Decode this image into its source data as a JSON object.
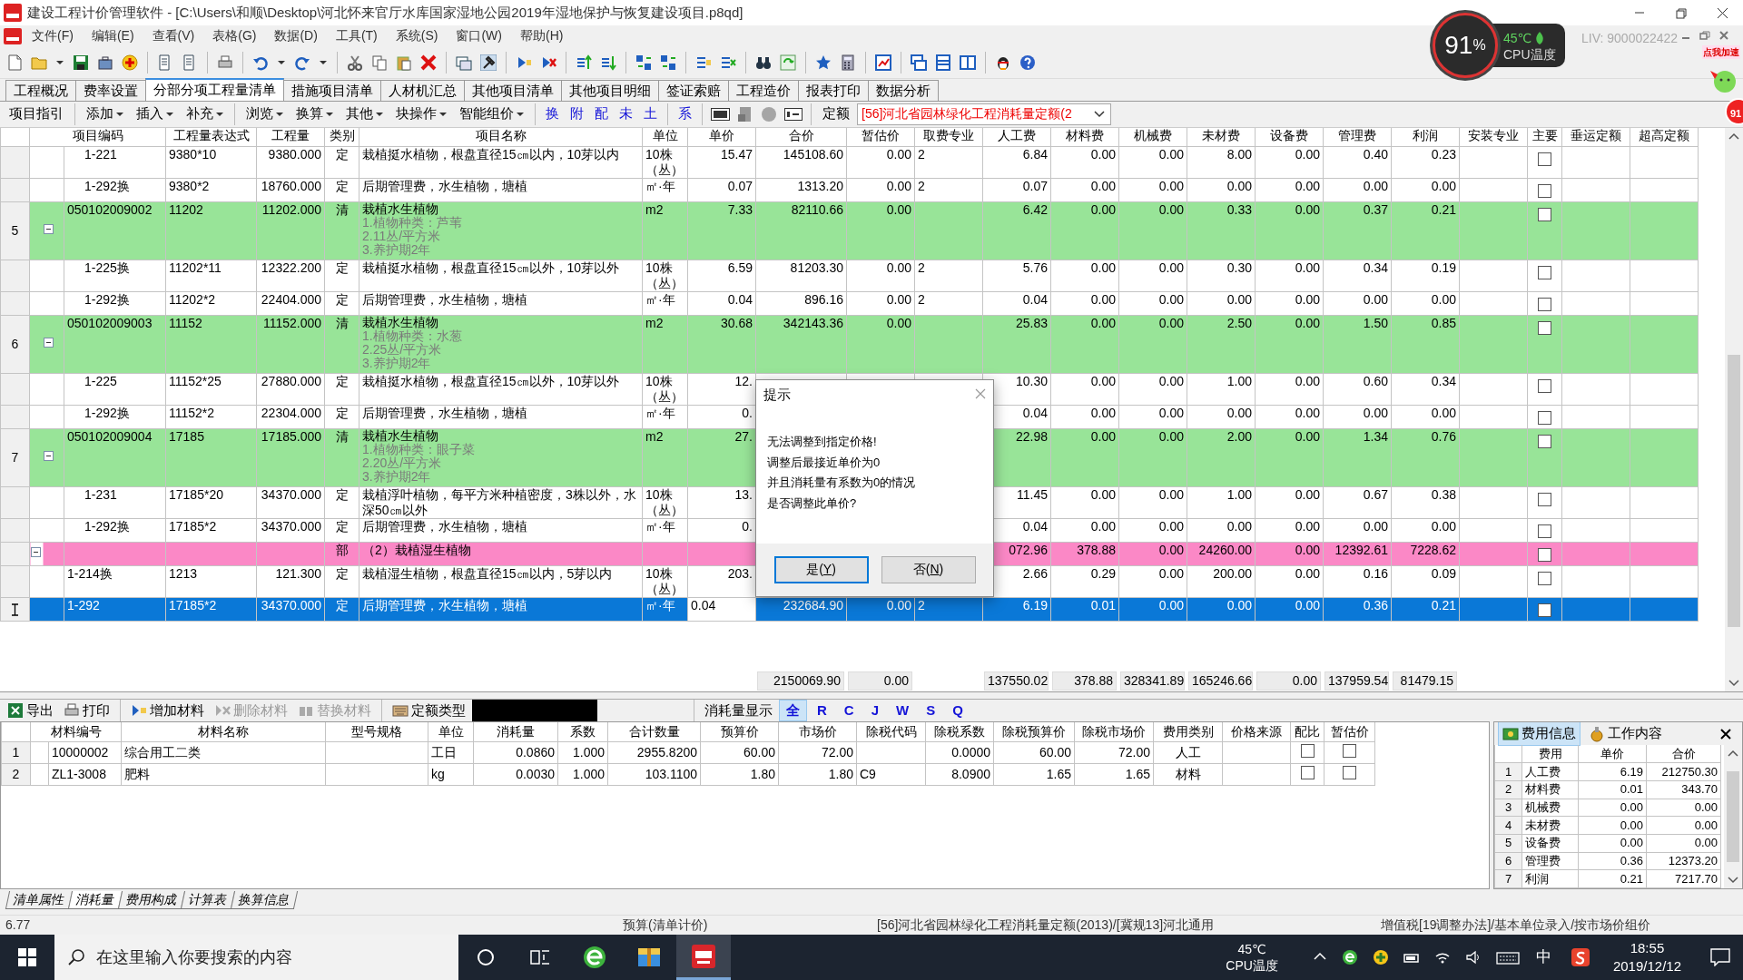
{
  "window": {
    "title": "建设工程计价管理软件 - [C:\\Users\\和顺\\Desktop\\河北怀来官厅水库国家湿地公园2019年湿地保护与恢复建设项目.p8qd]"
  },
  "menu": [
    "文件(F)",
    "编辑(E)",
    "查看(V)",
    "表格(G)",
    "数据(D)",
    "工具(T)",
    "系统(S)",
    "窗口(W)",
    "帮助(H)"
  ],
  "cpu_widget": {
    "percent": "91",
    "percent_unit": "%",
    "temperature": "45℃",
    "label": "CPU温度"
  },
  "license": "LIV: 9000022422",
  "speedup_badge": "点我加速",
  "alert_badge": "91",
  "tabs": [
    {
      "label": "工程概况",
      "selected": false
    },
    {
      "label": "费率设置",
      "selected": false
    },
    {
      "label": "分部分项工程量清单",
      "selected": true
    },
    {
      "label": "措施项目清单",
      "selected": false
    },
    {
      "label": "人材机汇总",
      "selected": false
    },
    {
      "label": "其他项目清单",
      "selected": false
    },
    {
      "label": "其他项目明细",
      "selected": false
    },
    {
      "label": "签证索赔",
      "selected": false
    },
    {
      "label": "工程造价",
      "selected": false
    },
    {
      "label": "报表打印",
      "selected": false
    },
    {
      "label": "数据分析",
      "selected": false
    }
  ],
  "subtoolbar": {
    "items": [
      {
        "label": "项目指引",
        "dropdown": false
      },
      {
        "label": "添加",
        "dropdown": true
      },
      {
        "label": "插入",
        "dropdown": true
      },
      {
        "label": "补充",
        "dropdown": true
      },
      {
        "label": "浏览",
        "dropdown": true
      },
      {
        "label": "换算",
        "dropdown": true
      },
      {
        "label": "其他",
        "dropdown": true
      },
      {
        "label": "块操作",
        "dropdown": true
      },
      {
        "label": "智能组价",
        "dropdown": true
      }
    ],
    "quick": [
      "换",
      "附",
      "配",
      "未",
      "土"
    ],
    "quick_extra": "系",
    "quota_label": "定额",
    "quota_select": "[56]河北省园林绿化工程消耗量定额(2"
  },
  "grid": {
    "columns": [
      "项目编码",
      "工程量表达式",
      "工程量",
      "类别",
      "项目名称",
      "单位",
      "单价",
      "合价",
      "暂估价",
      "取费专业",
      "人工费",
      "材料费",
      "机械费",
      "未材费",
      "设备费",
      "管理费",
      "利润",
      "安装专业",
      "主要",
      "垂运定额",
      "超高定额"
    ],
    "rows": [
      {
        "kind": "quota",
        "selected": false,
        "code": "1-221",
        "expression": "9380*10",
        "quantity": "9380.000",
        "type": "定",
        "name": "栽植挺水植物，根盘直径15㎝以内，10芽以内",
        "unit": "10株（丛）",
        "unit_price": "15.47",
        "total": "145108.60",
        "provisional": "0.00",
        "fee_specialty": "2",
        "labor": "6.84",
        "material": "0.00",
        "machinery": "0.00",
        "main_material": "8.00",
        "equipment": "0.00",
        "management": "0.40",
        "profit": "0.23",
        "major": false
      },
      {
        "kind": "quota",
        "selected": false,
        "code": "1-292换",
        "expression": "9380*2",
        "quantity": "18760.000",
        "type": "定",
        "name": "后期管理费，水生植物，塘植",
        "unit": "㎡·年",
        "unit_price": "0.07",
        "total": "1313.20",
        "provisional": "0.00",
        "fee_specialty": "2",
        "labor": "0.07",
        "material": "0.00",
        "machinery": "0.00",
        "main_material": "0.00",
        "equipment": "0.00",
        "management": "0.00",
        "profit": "0.00",
        "major": false
      },
      {
        "kind": "item",
        "selected": false,
        "row_number": "5",
        "expanded": true,
        "code": "050102009002",
        "expression": "11202",
        "quantity": "11202.000",
        "type": "清",
        "name": "栽植水生植物",
        "spec": [
          "1.植物种类：芦苇",
          "2.11丛/平方米",
          "3.养护期2年"
        ],
        "unit": "m2",
        "unit_price": "7.33",
        "total": "82110.66",
        "provisional": "0.00",
        "labor": "6.42",
        "material": "0.00",
        "machinery": "0.00",
        "main_material": "0.33",
        "equipment": "0.00",
        "management": "0.37",
        "profit": "0.21",
        "major": false,
        "children": [
          {
            "kind": "quota",
            "selected": false,
            "code": "1-225换",
            "expression": "11202*11",
            "quantity": "12322.200",
            "type": "定",
            "name": "栽植挺水植物，根盘直径15㎝以外，10芽以外",
            "unit": "10株（丛）",
            "unit_price": "6.59",
            "total": "81203.30",
            "provisional": "0.00",
            "fee_specialty": "2",
            "labor": "5.76",
            "material": "0.00",
            "machinery": "0.00",
            "main_material": "0.30",
            "equipment": "0.00",
            "management": "0.34",
            "profit": "0.19",
            "major": false
          },
          {
            "kind": "quota",
            "selected": false,
            "code": "1-292换",
            "expression": "11202*2",
            "quantity": "22404.000",
            "type": "定",
            "name": "后期管理费，水生植物，塘植",
            "unit": "㎡·年",
            "unit_price": "0.04",
            "total": "896.16",
            "provisional": "0.00",
            "fee_specialty": "2",
            "labor": "0.04",
            "material": "0.00",
            "machinery": "0.00",
            "main_material": "0.00",
            "equipment": "0.00",
            "management": "0.00",
            "profit": "0.00",
            "major": false
          }
        ]
      },
      {
        "kind": "item",
        "selected": false,
        "row_number": "6",
        "expanded": true,
        "code": "050102009003",
        "expression": "11152",
        "quantity": "11152.000",
        "type": "清",
        "name": "栽植水生植物",
        "spec": [
          "1.植物种类：水葱",
          "2.25丛/平方米",
          "3.养护期2年"
        ],
        "unit": "m2",
        "unit_price": "30.68",
        "total": "342143.36",
        "provisional": "0.00",
        "labor": "25.83",
        "material": "0.00",
        "machinery": "0.00",
        "main_material": "2.50",
        "equipment": "0.00",
        "management": "1.50",
        "profit": "0.85",
        "major": false,
        "children": [
          {
            "kind": "quota",
            "selected": false,
            "code": "1-225",
            "expression": "11152*25",
            "quantity": "27880.000",
            "type": "定",
            "name": "栽植挺水植物，根盘直径15㎝以外，10芽以外",
            "unit": "10株（丛）",
            "unit_price": "12.",
            "labor": "10.30",
            "material": "0.00",
            "machinery": "0.00",
            "main_material": "1.00",
            "equipment": "0.00",
            "management": "0.60",
            "profit": "0.34",
            "major": false
          },
          {
            "kind": "quota",
            "selected": false,
            "code": "1-292换",
            "expression": "11152*2",
            "quantity": "22304.000",
            "type": "定",
            "name": "后期管理费，水生植物，塘植",
            "unit": "㎡·年",
            "unit_price": "0.",
            "labor": "0.04",
            "material": "0.00",
            "machinery": "0.00",
            "main_material": "0.00",
            "equipment": "0.00",
            "management": "0.00",
            "profit": "0.00",
            "major": false
          }
        ]
      },
      {
        "kind": "item",
        "selected": false,
        "row_number": "7",
        "expanded": true,
        "code": "050102009004",
        "expression": "17185",
        "quantity": "17185.000",
        "type": "清",
        "name": "栽植水生植物",
        "spec": [
          "1.植物种类：眼子菜",
          "2.20丛/平方米",
          "3.养护期2年"
        ],
        "unit": "m2",
        "unit_price": "27.",
        "labor": "22.98",
        "material": "0.00",
        "machinery": "0.00",
        "main_material": "2.00",
        "equipment": "0.00",
        "management": "1.34",
        "profit": "0.76",
        "major": false,
        "children": [
          {
            "kind": "quota",
            "selected": false,
            "code": "1-231",
            "expression": "17185*20",
            "quantity": "34370.000",
            "type": "定",
            "name": "栽植浮叶植物，每平方米种植密度，3株以外，水深50㎝以外",
            "unit": "10株（丛）",
            "unit_price": "13.",
            "labor": "11.45",
            "material": "0.00",
            "machinery": "0.00",
            "main_material": "1.00",
            "equipment": "0.00",
            "management": "0.67",
            "profit": "0.38",
            "major": false
          },
          {
            "kind": "quota",
            "selected": false,
            "code": "1-292换",
            "expression": "17185*2",
            "quantity": "34370.000",
            "type": "定",
            "name": "后期管理费，水生植物，塘植",
            "unit": "㎡·年",
            "unit_price": "0.",
            "labor": "0.04",
            "material": "0.00",
            "machinery": "0.00",
            "main_material": "0.00",
            "equipment": "0.00",
            "management": "0.00",
            "profit": "0.00",
            "major": false
          }
        ]
      },
      {
        "kind": "division",
        "selected": false,
        "expanded": true,
        "type": "部",
        "name": "（2）栽植湿生植物",
        "labor": "072.96",
        "material": "378.88",
        "machinery": "0.00",
        "main_material": "24260.00",
        "equipment": "0.00",
        "management": "12392.61",
        "profit": "7228.62",
        "major": false,
        "children": [
          {
            "kind": "quota",
            "selected": false,
            "code": "1-214换",
            "expression": "1213",
            "quantity": "121.300",
            "type": "定",
            "name": "栽植湿生植物，根盘直径15㎝以内，5芽以内",
            "unit": "10株（丛）",
            "unit_price": "203.",
            "labor": "2.66",
            "material": "0.29",
            "machinery": "0.00",
            "main_material": "200.00",
            "equipment": "0.00",
            "management": "0.16",
            "profit": "0.09",
            "major": false
          },
          {
            "kind": "quota",
            "selected": true,
            "code": "1-292",
            "expression": "17185*2",
            "quantity": "34370.000",
            "type": "定",
            "name": "后期管理费，水生植物，塘植",
            "unit": "㎡·年",
            "unit_price": "0.04",
            "total": "232684.90",
            "provisional": "0.00",
            "fee_specialty": "2",
            "labor": "6.19",
            "material": "0.01",
            "machinery": "0.00",
            "main_material": "0.00",
            "equipment": "0.00",
            "management": "0.36",
            "profit": "0.21",
            "major": false
          }
        ]
      }
    ],
    "totals": {
      "total": "2150069.90",
      "provisional": "0.00",
      "labor": "137550.02",
      "material": "378.88",
      "machinery": "328341.89",
      "main_material": "165246.66",
      "equipment": "0.00",
      "management": "137959.54",
      "profit": "81479.15"
    }
  },
  "dialog": {
    "title": "提示",
    "lines": [
      "无法调整到指定价格!",
      "调整后最接近单价为0",
      "并且消耗量有系数为0的情况",
      "是否调整此单价?"
    ],
    "buttons": [
      {
        "label": "是(Y)",
        "default": true
      },
      {
        "label": "否(N)",
        "default": false
      }
    ]
  },
  "materials_toolbar": {
    "buttons": [
      {
        "label": "导出",
        "disabled": false
      },
      {
        "label": "打印",
        "disabled": false
      },
      {
        "label": "增加材料",
        "disabled": false
      },
      {
        "label": "删除材料",
        "disabled": true
      },
      {
        "label": "替换材料",
        "disabled": true
      },
      {
        "label": "定额类型",
        "disabled": false
      }
    ],
    "display_label": "消耗量显示",
    "filters": [
      {
        "label": "全",
        "selected": true
      },
      {
        "label": "R",
        "selected": false
      },
      {
        "label": "C",
        "selected": false
      },
      {
        "label": "J",
        "selected": false
      },
      {
        "label": "W",
        "selected": false
      },
      {
        "label": "S",
        "selected": false
      },
      {
        "label": "Q",
        "selected": false
      }
    ]
  },
  "materials": {
    "columns": [
      "材料编号",
      "材料名称",
      "型号规格",
      "单位",
      "消耗量",
      "系数",
      "合计数量",
      "预算价",
      "市场价",
      "除税代码",
      "除税系数",
      "除税预算价",
      "除税市场价",
      "费用类别",
      "价格来源",
      "配比",
      "暂估价"
    ],
    "rows": [
      {
        "index": "1",
        "code": "10000002",
        "name": "综合用工二类",
        "unit": "工日",
        "consumption": "0.0860",
        "coefficient": "1.000",
        "total_qty": "2955.8200",
        "budget_price": "60.00",
        "market_price": "72.00",
        "tax_coefficient": "0.0000",
        "tax_budget_price": "60.00",
        "tax_market_price": "72.00",
        "category": "人工",
        "ratio": false,
        "provisional": false
      },
      {
        "index": "2",
        "code": "ZL1-3008",
        "name": "肥料",
        "unit": "kg",
        "consumption": "0.0030",
        "coefficient": "1.000",
        "total_qty": "103.1100",
        "budget_price": "1.80",
        "market_price": "1.80",
        "tax_code": "C9",
        "tax_coefficient": "8.0900",
        "tax_budget_price": "1.65",
        "tax_market_price": "1.65",
        "category": "材料",
        "ratio": false,
        "provisional": false
      }
    ]
  },
  "fee_panel": {
    "tabs": [
      {
        "label": "费用信息",
        "selected": true
      },
      {
        "label": "工作内容",
        "selected": false
      }
    ],
    "columns": [
      "费用",
      "单价",
      "合价"
    ],
    "rows": [
      {
        "index": "1",
        "name": "人工费",
        "unit_price": "6.19",
        "total": "212750.30"
      },
      {
        "index": "2",
        "name": "材料费",
        "unit_price": "0.01",
        "total": "343.70"
      },
      {
        "index": "3",
        "name": "机械费",
        "unit_price": "0.00",
        "total": "0.00"
      },
      {
        "index": "4",
        "name": "未材费",
        "unit_price": "0.00",
        "total": "0.00"
      },
      {
        "index": "5",
        "name": "设备费",
        "unit_price": "0.00",
        "total": "0.00"
      },
      {
        "index": "6",
        "name": "管理费",
        "unit_price": "0.36",
        "total": "12373.20"
      },
      {
        "index": "7",
        "name": "利润",
        "unit_price": "0.21",
        "total": "7217.70"
      }
    ]
  },
  "bottom_tabs": [
    {
      "label": "清单属性",
      "selected": false
    },
    {
      "label": "消耗量",
      "selected": true
    },
    {
      "label": "费用构成",
      "selected": false
    },
    {
      "label": "计算表",
      "selected": false
    },
    {
      "label": "换算信息",
      "selected": false
    }
  ],
  "status_bar": [
    "6.77",
    "预算(清单计价)",
    "[56]河北省园林绿化工程消耗量定额(2013)/[冀规13]河北通用",
    "增值税[19调整办法]/基本单位录入/按市场价组价"
  ],
  "taskbar": {
    "search_placeholder": "在这里输入你要搜索的内容",
    "apps": [
      {
        "kind": "browser",
        "selected": false
      },
      {
        "kind": "archive",
        "selected": false
      },
      {
        "kind": "pt",
        "selected": true
      }
    ],
    "cpu_temperature": "45℃",
    "cpu_label": "CPU温度",
    "ime": "中",
    "time": "18:55",
    "date": "2019/12/12"
  }
}
